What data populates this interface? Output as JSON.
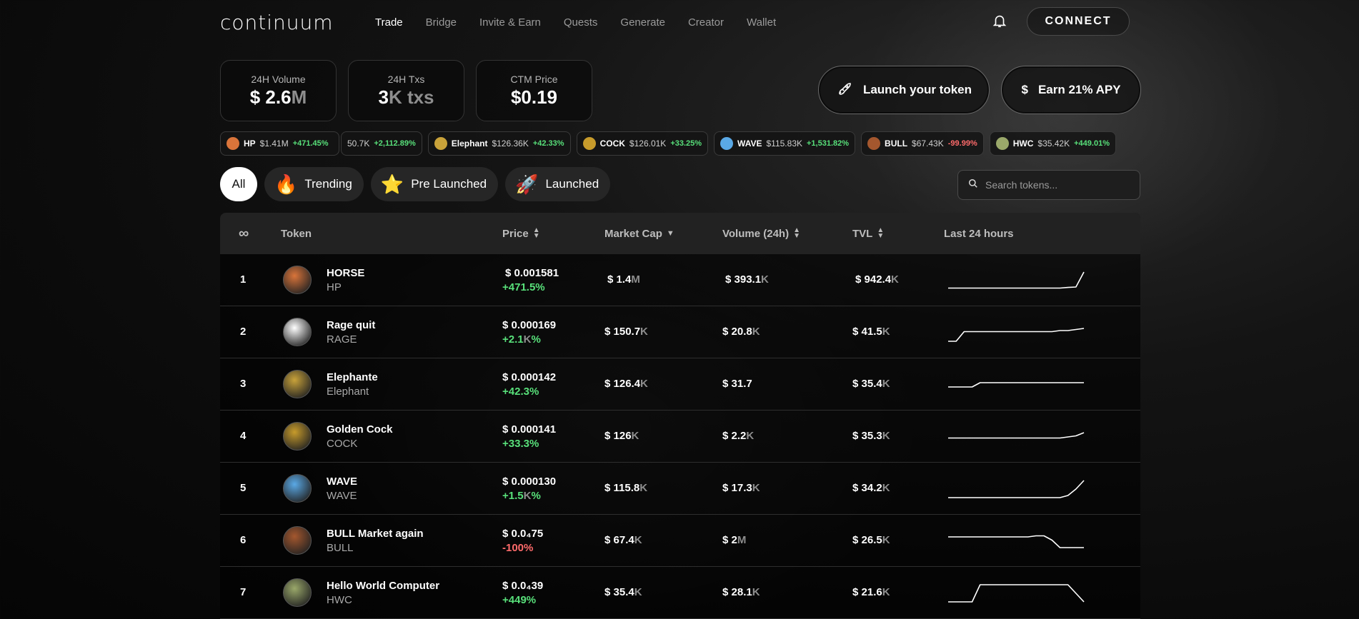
{
  "brand": {
    "logo": "continuum"
  },
  "nav": [
    "Trade",
    "Bridge",
    "Invite & Earn",
    "Quests",
    "Generate",
    "Creator",
    "Wallet"
  ],
  "header": {
    "connect_label": "CONNECT"
  },
  "stats": [
    {
      "label": "24H Volume",
      "value": "$ 2.6",
      "unit": "M"
    },
    {
      "label": "24H Txs",
      "value": "3",
      "unit": "K txs"
    },
    {
      "label": "CTM Price",
      "value": "$0.19",
      "unit": ""
    }
  ],
  "cta": {
    "launch_label": "Launch your token",
    "earn_label": "Earn 21% APY",
    "earn_icon": "$"
  },
  "ticker": [
    {
      "symbol": "HP",
      "price": "$1.41M",
      "change": "+471.45%",
      "dir": "up",
      "color": "#d9743a"
    },
    {
      "symbol": "",
      "price": "50.7K",
      "change": "+2,112.89%",
      "dir": "up",
      "color": ""
    },
    {
      "symbol": "Elephant",
      "price": "$126.36K",
      "change": "+42.33%",
      "dir": "up",
      "color": "#c8a23a"
    },
    {
      "symbol": "COCK",
      "price": "$126.01K",
      "change": "+33.25%",
      "dir": "up",
      "color": "#c79b2b"
    },
    {
      "symbol": "WAVE",
      "price": "$115.83K",
      "change": "+1,531.82%",
      "dir": "up",
      "color": "#5aa9e6"
    },
    {
      "symbol": "BULL",
      "price": "$67.43K",
      "change": "-99.99%",
      "dir": "down",
      "color": "#a4572e"
    },
    {
      "symbol": "HWC",
      "price": "$35.42K",
      "change": "+449.01%",
      "dir": "up",
      "color": "#9aa86a"
    }
  ],
  "filters": {
    "all": "All",
    "trending": "Trending",
    "pre": "Pre Launched",
    "launched": "Launched"
  },
  "search": {
    "placeholder": "Search tokens..."
  },
  "table": {
    "headers": {
      "rank": "∞",
      "token": "Token",
      "price": "Price",
      "mcap": "Market Cap",
      "volume": "Volume (24h)",
      "tvl": "TVL",
      "last24": "Last 24 hours"
    },
    "rows": [
      {
        "rank": "1",
        "name": "HORSE",
        "symbol": "HP",
        "price": "$ 0.001581",
        "change": "+471.5%",
        "dir": "up",
        "mcap": "$ 1.4",
        "mcap_u": "M",
        "vol": "$ 393.1",
        "vol_u": "K",
        "tvl": "$ 942.4",
        "tvl_u": "K",
        "color": "#d9743a",
        "spark": [
          0.15,
          0.15,
          0.15,
          0.15,
          0.15,
          0.15,
          0.15,
          0.15,
          0.15,
          0.15,
          0.15,
          0.15,
          0.15,
          0.15,
          0.15,
          0.18,
          0.2,
          0.9
        ]
      },
      {
        "rank": "2",
        "name": "Rage quit",
        "symbol": "RAGE",
        "price": "$ 0.000169",
        "change": "+2.1",
        "change_u": "K",
        "change_tail": "%",
        "dir": "up",
        "mcap": "$ 150.7",
        "mcap_u": "K",
        "vol": "$ 20.8",
        "vol_u": "K",
        "tvl": "$ 41.5",
        "tvl_u": "K",
        "color": "#ffffff",
        "spark": [
          0.1,
          0.1,
          0.55,
          0.55,
          0.55,
          0.55,
          0.55,
          0.55,
          0.55,
          0.55,
          0.55,
          0.55,
          0.55,
          0.55,
          0.6,
          0.6,
          0.65,
          0.7
        ]
      },
      {
        "rank": "3",
        "name": "Elephante",
        "symbol": "Elephant",
        "price": "$ 0.000142",
        "change": "+42.3%",
        "dir": "up",
        "mcap": "$ 126.4",
        "mcap_u": "K",
        "vol": "$ 31.7",
        "vol_u": "",
        "tvl": "$ 35.4",
        "tvl_u": "K",
        "color": "#c8a23a",
        "spark": [
          0.4,
          0.4,
          0.4,
          0.4,
          0.6,
          0.6,
          0.6,
          0.6,
          0.6,
          0.6,
          0.6,
          0.6,
          0.6,
          0.6,
          0.6,
          0.6,
          0.6,
          0.6
        ]
      },
      {
        "rank": "4",
        "name": "Golden Cock",
        "symbol": "COCK",
        "price": "$ 0.000141",
        "change": "+33.3%",
        "dir": "up",
        "mcap": "$ 126",
        "mcap_u": "K",
        "vol": "$ 2.2",
        "vol_u": "K",
        "tvl": "$ 35.3",
        "tvl_u": "K",
        "color": "#c79b2b",
        "spark": [
          0.45,
          0.45,
          0.45,
          0.45,
          0.45,
          0.45,
          0.45,
          0.45,
          0.45,
          0.45,
          0.45,
          0.45,
          0.45,
          0.45,
          0.45,
          0.5,
          0.55,
          0.7
        ]
      },
      {
        "rank": "5",
        "name": "WAVE",
        "symbol": "WAVE",
        "price": "$ 0.000130",
        "change": "+1.5",
        "change_u": "K",
        "change_tail": "%",
        "dir": "up",
        "mcap": "$ 115.8",
        "mcap_u": "K",
        "vol": "$ 17.3",
        "vol_u": "K",
        "tvl": "$ 34.2",
        "tvl_u": "K",
        "color": "#5aa9e6",
        "spark": [
          0.1,
          0.1,
          0.1,
          0.1,
          0.1,
          0.1,
          0.1,
          0.1,
          0.1,
          0.1,
          0.1,
          0.1,
          0.1,
          0.1,
          0.1,
          0.2,
          0.5,
          0.9
        ]
      },
      {
        "rank": "6",
        "name": "BULL Market again",
        "symbol": "BULL",
        "price": "$ 0.0₄75",
        "change": "-100%",
        "dir": "down",
        "mcap": "$ 67.4",
        "mcap_u": "K",
        "vol": "$ 2",
        "vol_u": "M",
        "tvl": "$ 26.5",
        "tvl_u": "K",
        "color": "#a4572e",
        "spark": [
          0.7,
          0.7,
          0.7,
          0.7,
          0.7,
          0.7,
          0.7,
          0.7,
          0.7,
          0.7,
          0.7,
          0.75,
          0.75,
          0.55,
          0.2,
          0.2,
          0.2,
          0.2
        ]
      },
      {
        "rank": "7",
        "name": "Hello World Computer",
        "symbol": "HWC",
        "price": "$ 0.0₄39",
        "change": "+449%",
        "dir": "up",
        "mcap": "$ 35.4",
        "mcap_u": "K",
        "vol": "$ 28.1",
        "vol_u": "K",
        "tvl": "$ 21.6",
        "tvl_u": "K",
        "color": "#9aa86a",
        "spark": [
          0.1,
          0.1,
          0.1,
          0.1,
          0.9,
          0.9,
          0.9,
          0.9,
          0.9,
          0.9,
          0.9,
          0.9,
          0.9,
          0.9,
          0.9,
          0.9,
          0.5,
          0.1
        ]
      }
    ]
  }
}
